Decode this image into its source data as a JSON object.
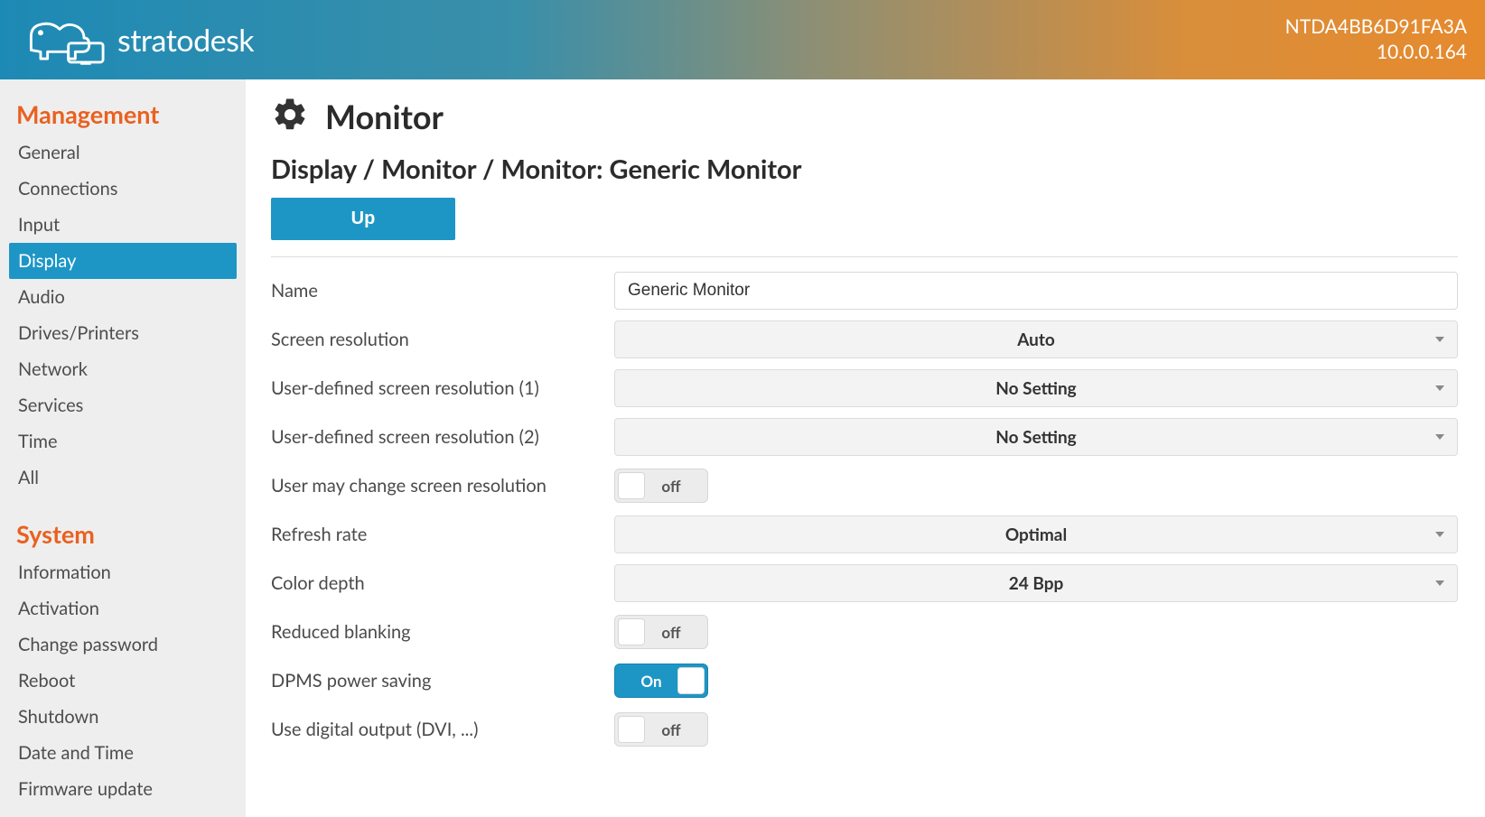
{
  "header": {
    "brand": "stratodesk",
    "device_id": "NTDA4BB6D91FA3A",
    "ip": "10.0.0.164"
  },
  "sidebar": {
    "sections": [
      {
        "title": "Management",
        "items": [
          {
            "label": "General",
            "active": false
          },
          {
            "label": "Connections",
            "active": false
          },
          {
            "label": "Input",
            "active": false
          },
          {
            "label": "Display",
            "active": true
          },
          {
            "label": "Audio",
            "active": false
          },
          {
            "label": "Drives/Printers",
            "active": false
          },
          {
            "label": "Network",
            "active": false
          },
          {
            "label": "Services",
            "active": false
          },
          {
            "label": "Time",
            "active": false
          },
          {
            "label": "All",
            "active": false
          }
        ]
      },
      {
        "title": "System",
        "items": [
          {
            "label": "Information",
            "active": false
          },
          {
            "label": "Activation",
            "active": false
          },
          {
            "label": "Change password",
            "active": false
          },
          {
            "label": "Reboot",
            "active": false
          },
          {
            "label": "Shutdown",
            "active": false
          },
          {
            "label": "Date and Time",
            "active": false
          },
          {
            "label": "Firmware update",
            "active": false
          }
        ]
      }
    ]
  },
  "main": {
    "title": "Monitor",
    "breadcrumb": "Display / Monitor / Monitor: Generic Monitor",
    "up_label": "Up",
    "fields": [
      {
        "label": "Name",
        "type": "text",
        "value": "Generic Monitor"
      },
      {
        "label": "Screen resolution",
        "type": "select",
        "value": "Auto"
      },
      {
        "label": "User-defined screen resolution (1)",
        "type": "select",
        "value": "No Setting"
      },
      {
        "label": "User-defined screen resolution (2)",
        "type": "select",
        "value": "No Setting"
      },
      {
        "label": "User may change screen resolution",
        "type": "toggle",
        "value": "off"
      },
      {
        "label": "Refresh rate",
        "type": "select",
        "value": "Optimal"
      },
      {
        "label": "Color depth",
        "type": "select",
        "value": "24 Bpp"
      },
      {
        "label": "Reduced blanking",
        "type": "toggle",
        "value": "off"
      },
      {
        "label": "DPMS power saving",
        "type": "toggle",
        "value": "On"
      },
      {
        "label": "Use digital output (DVI, ...)",
        "type": "toggle",
        "value": "off"
      }
    ]
  }
}
